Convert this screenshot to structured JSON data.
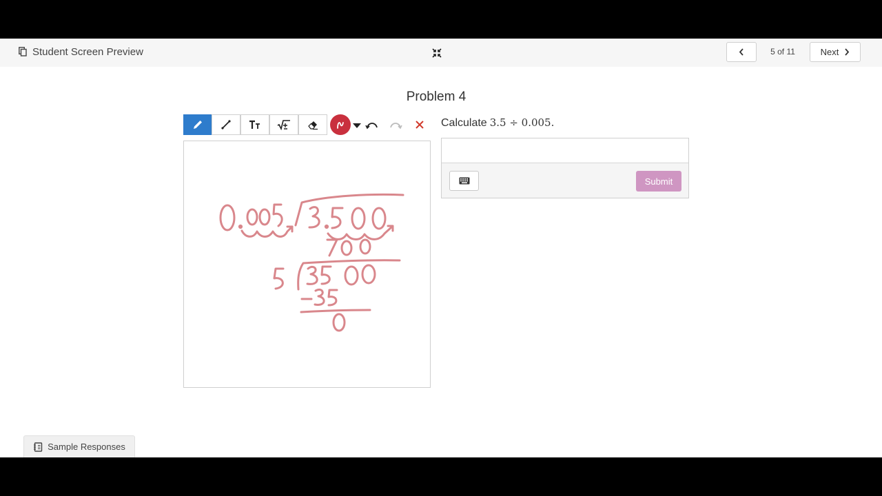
{
  "header": {
    "title": "Student Screen Preview",
    "page_counter": "5 of 11",
    "next_label": "Next"
  },
  "problem": {
    "title": "Problem 4",
    "prompt": "Calculate",
    "expression": "3.5 ÷ 0.005."
  },
  "toolbar": {
    "tools": [
      "pencil",
      "line",
      "text",
      "math",
      "eraser"
    ],
    "active_tool": "pencil",
    "ink_color": "#c9303e"
  },
  "answer": {
    "value": "",
    "placeholder": "",
    "submit_label": "Submit"
  },
  "footer": {
    "sample_responses_label": "Sample Responses"
  },
  "colors": {
    "accent": "#2e7ccc",
    "ink": "#c9303e",
    "sketch": "#d9878c",
    "submit": "#cf96c2"
  }
}
